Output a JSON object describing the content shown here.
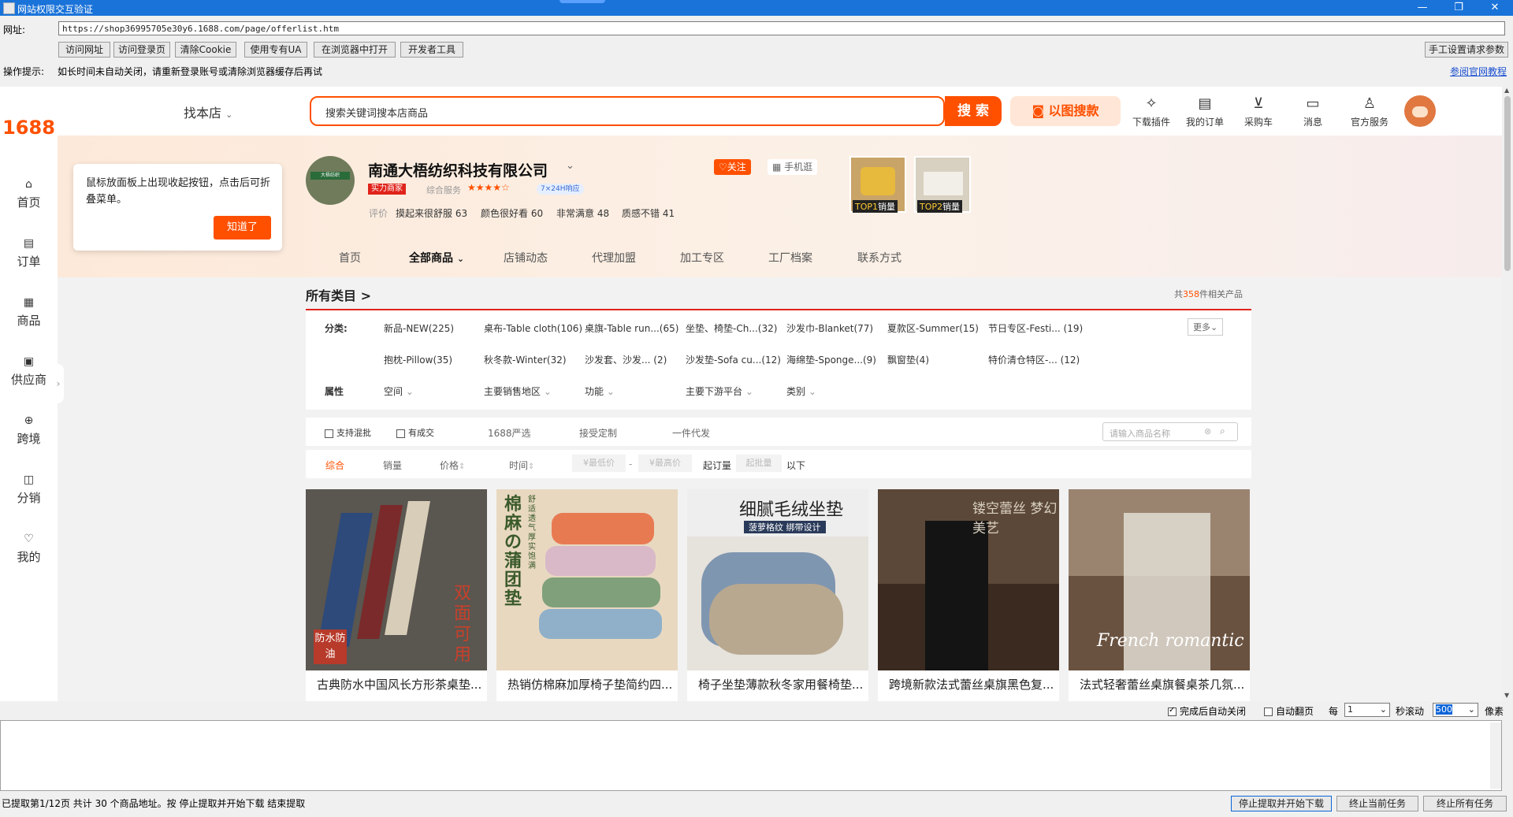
{
  "window": {
    "title": "网站权限交互验证",
    "minimize": "—",
    "maximize": "❐",
    "close": "✕"
  },
  "address": {
    "label": "网址:",
    "url": "https://shop36995705e30y6.1688.com/page/offerlist.htm"
  },
  "toolbar": {
    "visit": "访问网址",
    "visit_login": "访问登录页",
    "clear_cookie": "清除Cookie",
    "use_ua": "使用专有UA",
    "open_browser": "在浏览器中打开",
    "devtools": "开发者工具",
    "manual_headers": "手工设置请求参数"
  },
  "hint": {
    "label": "操作提示:",
    "text": "如长时间未自动关闭，请重新登录账号或清除浏览器缓存后再试",
    "link": "参阅官网教程"
  },
  "site": {
    "logo": "1688",
    "nav": [
      "首页",
      "订单",
      "商品",
      "供应商",
      "跨境",
      "分销",
      "我的"
    ],
    "find_shop": "找本店",
    "search_placeholder": "搜索关键词搜本店商品",
    "search_btn": "搜 索",
    "image_search": "以图搜款",
    "header_icons": [
      "下载插件",
      "我的订单",
      "采购车",
      "消息",
      "官方服务"
    ]
  },
  "popup": {
    "text": "鼠标放面板上出现收起按钮，点击后可折叠菜单。",
    "button": "知道了"
  },
  "shop": {
    "name": "南通大梧纺织科技有限公司",
    "badge": "实力商家",
    "service_label": "综合服务",
    "stars": "★★★★☆",
    "response": "7×24H响应",
    "follow": "关注",
    "mobile": "手机逛",
    "eval_label": "评价",
    "evals": [
      "摸起来很舒服 63",
      "颜色很好看 60",
      "非常满意 48",
      "质感不错 41"
    ],
    "top_badges": [
      {
        "rank": "TOP1",
        "label": "销量"
      },
      {
        "rank": "TOP2",
        "label": "销量"
      }
    ],
    "tabs": [
      "首页",
      "全部商品",
      "店铺动态",
      "代理加盟",
      "加工专区",
      "工厂档案",
      "联系方式"
    ]
  },
  "category": {
    "title": "所有类目 >",
    "count_prefix": "共",
    "count": "358",
    "count_suffix": "件相关产品",
    "cat_label": "分类:",
    "row1": [
      "新品-NEW(225)",
      "桌布-Table cloth(106)",
      "桌旗-Table run...(65)",
      "坐垫、椅垫-Ch...(32)",
      "沙发巾-Blanket(77)",
      "夏款区-Summer(15)",
      "节日专区-Festi... (19)"
    ],
    "row2": [
      "抱枕-Pillow(35)",
      "秋冬款-Winter(32)",
      "沙发套、沙发... (2)",
      "沙发垫-Sofa cu...(12)",
      "海绵垫-Sponge...(9)",
      "飘窗垫(4)",
      "特价清仓特区-... (12)"
    ],
    "more": "更多",
    "attr_label": "属性",
    "attrs": [
      "空间",
      "主要销售地区",
      "功能",
      "主要下游平台",
      "类别"
    ]
  },
  "filters": {
    "mix": "支持混批",
    "deal": "有成交",
    "select": "1688严选",
    "custom": "接受定制",
    "dropship": "一件代发",
    "search_placeholder": "请输入商品名称",
    "sort": [
      "综合",
      "销量",
      "价格",
      "时间"
    ],
    "min_price": "¥最低价",
    "max_price": "¥最高价",
    "moq_label": "起订量",
    "moq_placeholder": "起批量",
    "below": "以下"
  },
  "products": [
    {
      "title": "古典防水中国风长方形茶桌垫...",
      "overlay": "双面可用",
      "overlay2": "防水防油"
    },
    {
      "title": "热销仿棉麻加厚椅子垫简约四...",
      "overlay": "棉麻の蒲团垫",
      "overlay2": "舒适透气 厚实饱满"
    },
    {
      "title": "椅子坐垫薄款秋冬家用餐椅垫...",
      "overlay": "细腻毛绒坐垫",
      "overlay2": "菠萝格纹 绑带设计"
    },
    {
      "title": "跨境新款法式蕾丝桌旗黑色复...",
      "overlay": "镂空蕾丝 梦幻美艺"
    },
    {
      "title": "法式轻奢蕾丝桌旗餐桌茶几氛...",
      "overlay": "French romantic"
    }
  ],
  "controls": {
    "auto_close": "完成后自动关闭",
    "auto_page": "自动翻页",
    "every": "每",
    "every_val": "1",
    "sec_scroll": "秒滚动",
    "pixels_val": "500",
    "pixels": "像素"
  },
  "status": {
    "text": "已提取第1/12页 共计 30 个商品地址。按 停止提取并开始下载 结束提取"
  },
  "bottom_buttons": {
    "stop_download": "停止提取并开始下载",
    "end_current": "终止当前任务",
    "end_all": "终止所有任务"
  },
  "colors": {
    "accent": "#ff5000",
    "titlebar": "#1a73d9"
  }
}
